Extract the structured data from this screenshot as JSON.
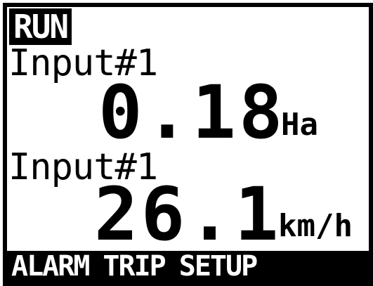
{
  "mode": "RUN",
  "displays": [
    {
      "label": "Input#1",
      "value": "0.18",
      "unit": "Ha"
    },
    {
      "label": "Input#1",
      "value": "26.1",
      "unit": "km/h"
    }
  ],
  "softkeys": [
    "ALARM",
    "TRIP",
    "SETUP"
  ]
}
